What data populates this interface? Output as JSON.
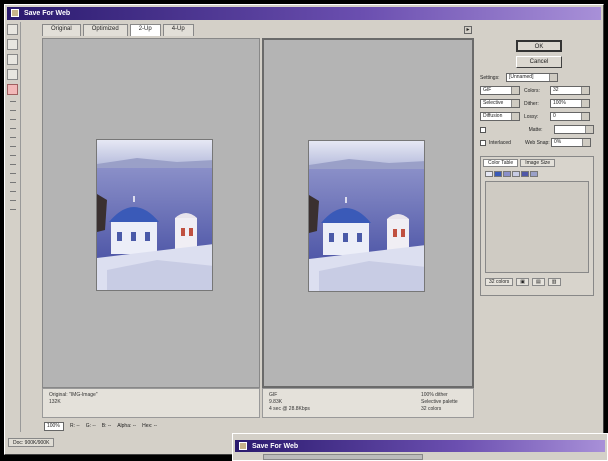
{
  "window": {
    "title": "Save For Web"
  },
  "tabs": [
    {
      "label": "Original"
    },
    {
      "label": "Optimized"
    },
    {
      "label": "2-Up"
    },
    {
      "label": "4-Up"
    }
  ],
  "buttons": {
    "ok": "OK",
    "cancel": "Cancel"
  },
  "settings": {
    "preset_label": "Settings:",
    "preset_value": "[Unnamed]",
    "format_value": "GIF",
    "colors_label": "Colors:",
    "colors_value": "32",
    "palette_value": "Selective",
    "dither_label": "Dither:",
    "dither_value": "100%",
    "dither_algo": "Diffusion",
    "lossy_label": "Lossy:",
    "lossy_value": "0",
    "matte_label": "Matte:",
    "interlaced_label": "Interlaced",
    "websnap_label": "Web Snap:",
    "websnap_value": "0%"
  },
  "palette_panel": {
    "tab_color_table": "Color Table",
    "tab_image_size": "Image Size",
    "colors_count": "32 colors"
  },
  "info": {
    "left_line1": "Original: \"IMG-Image\"",
    "left_line2": "132K",
    "right_line1": "GIF",
    "right_line2": "9.83K",
    "right_line3": "4 sec @ 28.8Kbps",
    "right_col2_line1": "100% dither",
    "right_col2_line2": "Selective palette",
    "right_col2_line3": "32 colors"
  },
  "zoom": {
    "value": "100%",
    "r": "R: --",
    "g": "G: --",
    "b": "B: --",
    "alpha": "Alpha: --",
    "hex": "Hex: --"
  },
  "status": {
    "item1": "Doc: 900K/900K"
  }
}
